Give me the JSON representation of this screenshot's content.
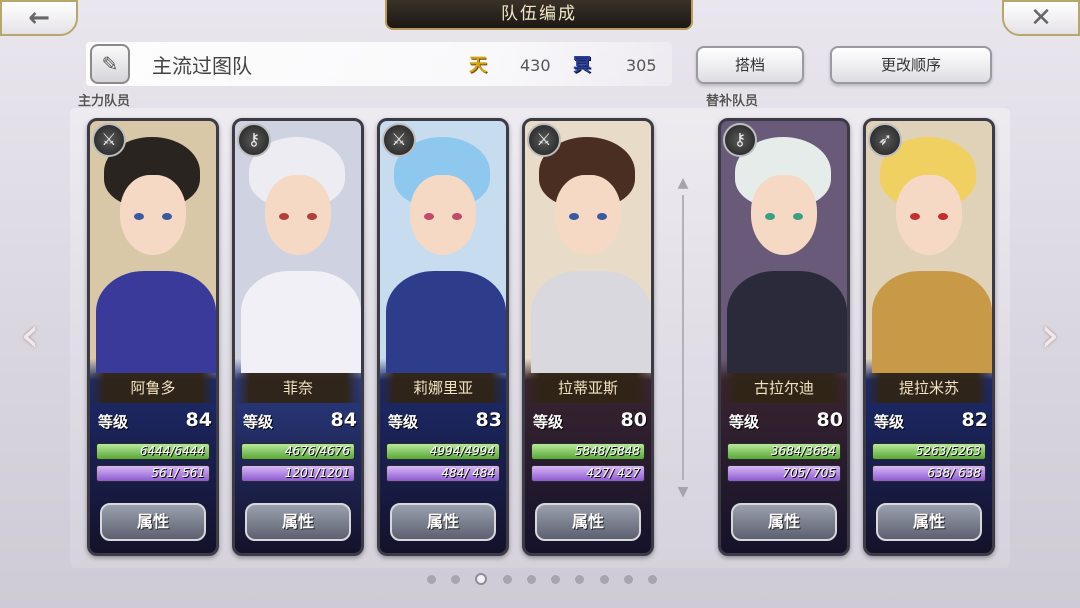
{
  "header": {
    "title": "队伍编成",
    "back_icon": "←",
    "close_icon": "✕"
  },
  "team": {
    "name": "主流过图队",
    "sky_glyph": "天",
    "sky_value": "430",
    "dark_glyph": "冥",
    "dark_value": "305",
    "edit_icon": "✎"
  },
  "buttons": {
    "partner": "搭档",
    "change_order": "更改顺序"
  },
  "sections": {
    "main": "主力队员",
    "sub": "替补队员"
  },
  "level_label": "等级",
  "attr_label": "属性",
  "nav": {
    "left": "‹",
    "right": "›",
    "divider_up": "▲",
    "divider_down": "▼"
  },
  "members": [
    {
      "name": "阿鲁多",
      "level": "84",
      "hp": "6444/6444",
      "mp": "561/ 561",
      "weapon": "⚔",
      "hair": "#2a2420",
      "body": "#3a3a9a",
      "bg": "#d8c8a8",
      "eye": "#3a5aa0",
      "frame": "#1d2a6a"
    },
    {
      "name": "菲奈",
      "level": "84",
      "hp": "4676/4676",
      "mp": "1201/1201",
      "weapon": "⚷",
      "hair": "#ececf2",
      "body": "#f0f0f6",
      "bg": "#cfd2e0",
      "eye": "#b04040",
      "frame": "#2a3a80"
    },
    {
      "name": "莉娜里亚",
      "level": "83",
      "hp": "4994/4994",
      "mp": "484/ 484",
      "weapon": "⚔",
      "hair": "#8ec8ee",
      "body": "#2e3c8c",
      "bg": "#c8dcef",
      "eye": "#c04a6a",
      "frame": "#1d2a6a"
    },
    {
      "name": "拉蒂亚斯",
      "level": "80",
      "hp": "5848/5848",
      "mp": "427/ 427",
      "weapon": "⚔",
      "hair": "#4a2e22",
      "body": "#d8d8de",
      "bg": "#e8dcc8",
      "eye": "#3a5aa0",
      "frame": "#3a2430"
    },
    {
      "name": "古拉尔迪",
      "level": "80",
      "hp": "3684/3684",
      "mp": "705/ 705",
      "weapon": "⚷",
      "hair": "#e6ecea",
      "body": "#2a2a3a",
      "bg": "#6a5a7a",
      "eye": "#3aa080",
      "frame": "#3a2430"
    },
    {
      "name": "提拉米苏",
      "level": "82",
      "hp": "5263/5263",
      "mp": "638/ 638",
      "weapon": "➶",
      "hair": "#f0d060",
      "body": "#c89a48",
      "bg": "#e0d2b8",
      "eye": "#c03030",
      "frame": "#1d2a6a"
    }
  ],
  "pagination": {
    "total": 10,
    "active": 2
  }
}
